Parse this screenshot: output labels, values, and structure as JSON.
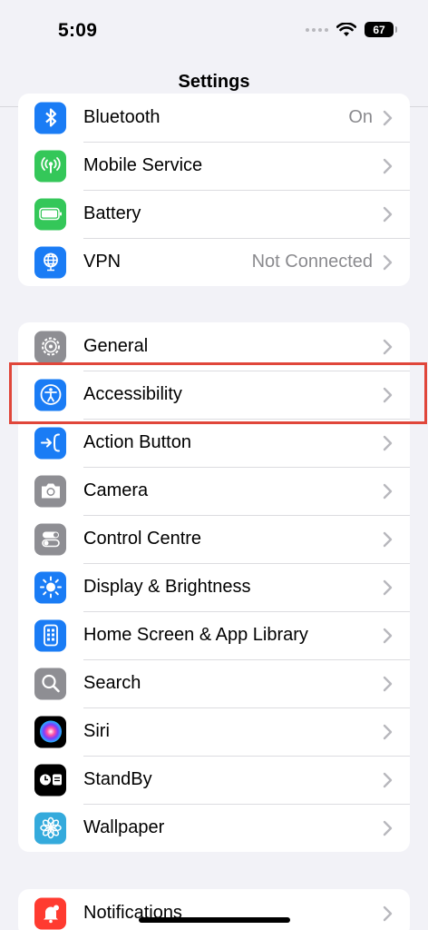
{
  "status": {
    "time": "5:09",
    "battery": "67"
  },
  "nav": {
    "title": "Settings"
  },
  "group1": [
    {
      "label": "Bluetooth",
      "value": "On",
      "icon": "bluetooth-icon",
      "color": "#1a7cf5"
    },
    {
      "label": "Mobile Service",
      "value": "",
      "icon": "antenna-icon",
      "color": "#34c759"
    },
    {
      "label": "Battery",
      "value": "",
      "icon": "battery-icon",
      "color": "#34c759"
    },
    {
      "label": "VPN",
      "value": "Not Connected",
      "icon": "globe-icon",
      "color": "#1a7cf5"
    }
  ],
  "group2": [
    {
      "label": "General",
      "icon": "gear-icon",
      "color": "#8e8e93"
    },
    {
      "label": "Accessibility",
      "icon": "accessibility-icon",
      "color": "#1a7cf5"
    },
    {
      "label": "Action Button",
      "icon": "action-button-icon",
      "color": "#1a7cf5"
    },
    {
      "label": "Camera",
      "icon": "camera-icon",
      "color": "#8e8e93"
    },
    {
      "label": "Control Centre",
      "icon": "toggles-icon",
      "color": "#8e8e93"
    },
    {
      "label": "Display & Brightness",
      "icon": "sun-icon",
      "color": "#1a7cf5"
    },
    {
      "label": "Home Screen & App Library",
      "icon": "home-screen-icon",
      "color": "#1a7cf5"
    },
    {
      "label": "Search",
      "icon": "search-icon",
      "color": "#8e8e93"
    },
    {
      "label": "Siri",
      "icon": "siri-icon",
      "color": "#000000"
    },
    {
      "label": "StandBy",
      "icon": "standby-icon",
      "color": "#000000"
    },
    {
      "label": "Wallpaper",
      "icon": "flower-icon",
      "color": "#34aadc"
    }
  ],
  "group3": [
    {
      "label": "Notifications",
      "icon": "bell-icon",
      "color": "#ff3b30"
    }
  ],
  "colors": {
    "highlight": "#e0463a",
    "background": "#f2f2f7"
  }
}
